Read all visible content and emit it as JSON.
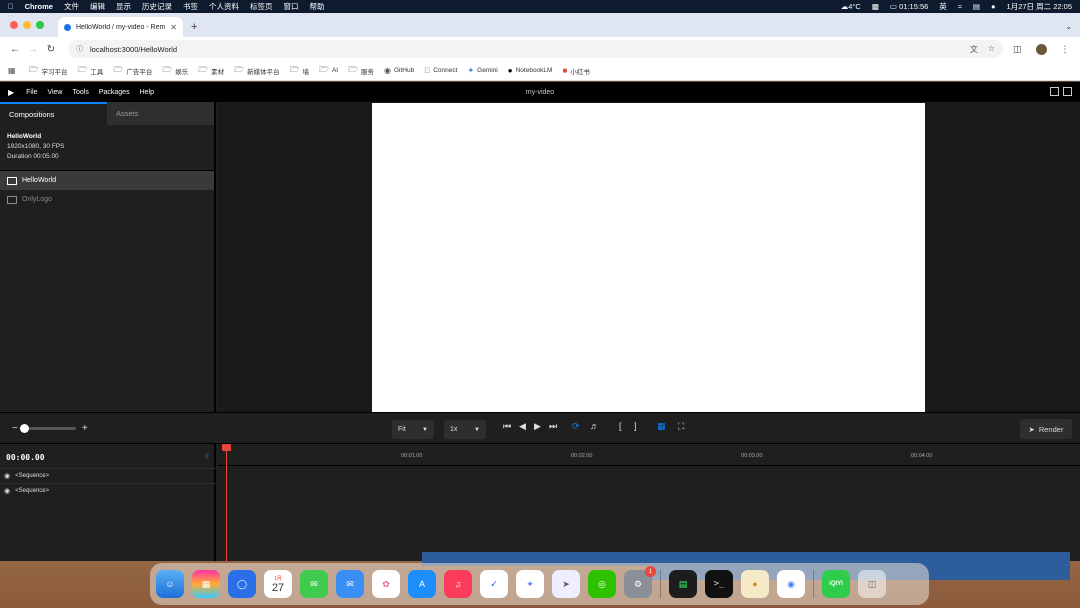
{
  "menubar": {
    "app": "Chrome",
    "items": [
      "文件",
      "编辑",
      "显示",
      "历史记录",
      "书签",
      "个人资料",
      "标签页",
      "窗口",
      "帮助"
    ],
    "weather": "4°C",
    "time": "01:15:56",
    "ime": "英",
    "datetime": "1月27日 周二  22:05"
  },
  "browser": {
    "tab_title": "HelloWorld / my-video - Rem",
    "url": "localhost:3000/HelloWorld",
    "bookmarks": [
      "学习平台",
      "工具",
      "广告平台",
      "娱乐",
      "素材",
      "新媒体平台",
      "墙",
      "AI",
      "服务",
      "GitHub",
      "Connect",
      "Gemini",
      "NotebookLM",
      "小红书"
    ]
  },
  "app": {
    "menu": [
      "File",
      "View",
      "Tools",
      "Packages",
      "Help"
    ],
    "title": "my-video",
    "panel_tabs": [
      "Compositions",
      "Assets"
    ],
    "comp_info": {
      "name": "HelloWorld",
      "meta": "1920x1080, 30 FPS",
      "duration": "Duration 00:05.00"
    },
    "compositions": [
      "HelloWorld",
      "OnlyLogo"
    ],
    "controls": {
      "fit": "Fit",
      "speed": "1x",
      "render": "Render"
    },
    "timeline": {
      "timecode": "00:00.00",
      "frame": "0",
      "ticks": [
        "00:01.00",
        "00:02.00",
        "00:03.00",
        "00:04.00"
      ],
      "tracks": [
        "<Sequence>",
        "<Sequence>"
      ]
    }
  },
  "dock": {
    "calendar_month": "1月",
    "calendar_day": "27",
    "badge": "1",
    "iqiyi": "iQIYI"
  }
}
